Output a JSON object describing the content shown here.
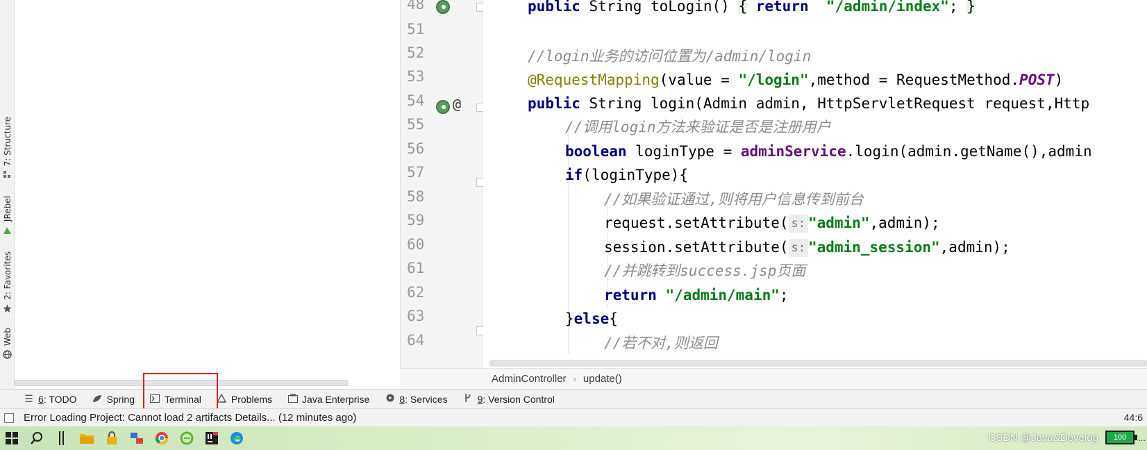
{
  "left_strip": {
    "tabs": [
      {
        "label": "7: Structure",
        "icon": "structure-icon"
      },
      {
        "label": "JRebel",
        "icon": "jrebel-icon"
      },
      {
        "label": "2: Favorites",
        "icon": "star-icon"
      },
      {
        "label": "Web",
        "icon": "web-icon"
      }
    ]
  },
  "editor": {
    "lines": [
      {
        "num": "48"
      },
      {
        "num": "51"
      },
      {
        "num": "52"
      },
      {
        "num": "53"
      },
      {
        "num": "54"
      },
      {
        "num": "55"
      },
      {
        "num": "56"
      },
      {
        "num": "57"
      },
      {
        "num": "58"
      },
      {
        "num": "59"
      },
      {
        "num": "60"
      },
      {
        "num": "61"
      },
      {
        "num": "62"
      },
      {
        "num": "63"
      },
      {
        "num": "64"
      }
    ],
    "code": {
      "l48": {
        "kw1": "public",
        "t1": " String toLogin() ",
        "b1": "{",
        "t2": " ",
        "kw2": "return",
        "t3": "  ",
        "s1": "\"/admin/index\"",
        "t4": "; ",
        "b2": "}"
      },
      "l52": {
        "c1": "//login业务的访问位置为/admin/login"
      },
      "l53": {
        "a1": "@RequestMapping",
        "t1": "(value = ",
        "s1": "\"/login\"",
        "t2": ",method = RequestMethod.",
        "p1": "POST",
        "t3": ")"
      },
      "l54": {
        "kw1": "public",
        "t1": " String login(Admin admin, HttpServletRequest request,Http"
      },
      "l55": {
        "c1": "//调用login方法来验证是否是注册用户"
      },
      "l56": {
        "kw1": "boolean",
        "t1": " loginType = ",
        "f1": "adminService",
        "t2": ".login(admin.getName(),admin"
      },
      "l57": {
        "kw1": "if",
        "t1": "(loginType){"
      },
      "l58": {
        "c1": "//如果验证通过,则将用户信息传到前台"
      },
      "l59": {
        "t1": "request.setAttribute(",
        "h1": "s:",
        "s1": "\"admin\"",
        "t2": ",admin);"
      },
      "l60": {
        "t1": "session.setAttribute(",
        "h1": "s:",
        "s1": "\"admin_session\"",
        "t2": ",admin);"
      },
      "l61": {
        "c1": "//并跳转到success.jsp页面"
      },
      "l62": {
        "kw1": "return",
        "t1": " ",
        "s1": "\"/admin/main\"",
        "t2": ";"
      },
      "l63": {
        "t1": "}",
        "kw1": "else",
        "t2": "{"
      },
      "l64": {
        "c1": "//若不对,则返回"
      }
    },
    "gutter_at": "@"
  },
  "breadcrumb": {
    "items": [
      "AdminController",
      "update()"
    ],
    "separator": "›"
  },
  "tool_windows": [
    {
      "prefix": "6",
      "label": ": TODO",
      "icon": "list-icon"
    },
    {
      "prefix": "",
      "label": "Spring",
      "icon": "spring-leaf-icon"
    },
    {
      "prefix": "",
      "label": "Terminal",
      "icon": "terminal-icon"
    },
    {
      "prefix": "",
      "label": "Problems",
      "icon": "warning-icon"
    },
    {
      "prefix": "",
      "label": "Java Enterprise",
      "icon": "java-enterprise-icon"
    },
    {
      "prefix": "8",
      "label": ": Services",
      "icon": "services-icon"
    },
    {
      "prefix": "9",
      "label": ": Version Control",
      "icon": "branch-icon"
    }
  ],
  "status": {
    "message": "Error Loading Project: Cannot load 2 artifacts Details... (12 minutes ago)",
    "position": "44:6"
  },
  "taskbar": {
    "watermark": "CSDN @Java&Develop",
    "battery": "100",
    "tail": "..."
  },
  "colors": {
    "keyword": "#000080",
    "string": "#067d17",
    "comment": "#8c8c8c",
    "annotation": "#808000",
    "field": "#660e7a",
    "highlight_box": "#e02020"
  }
}
